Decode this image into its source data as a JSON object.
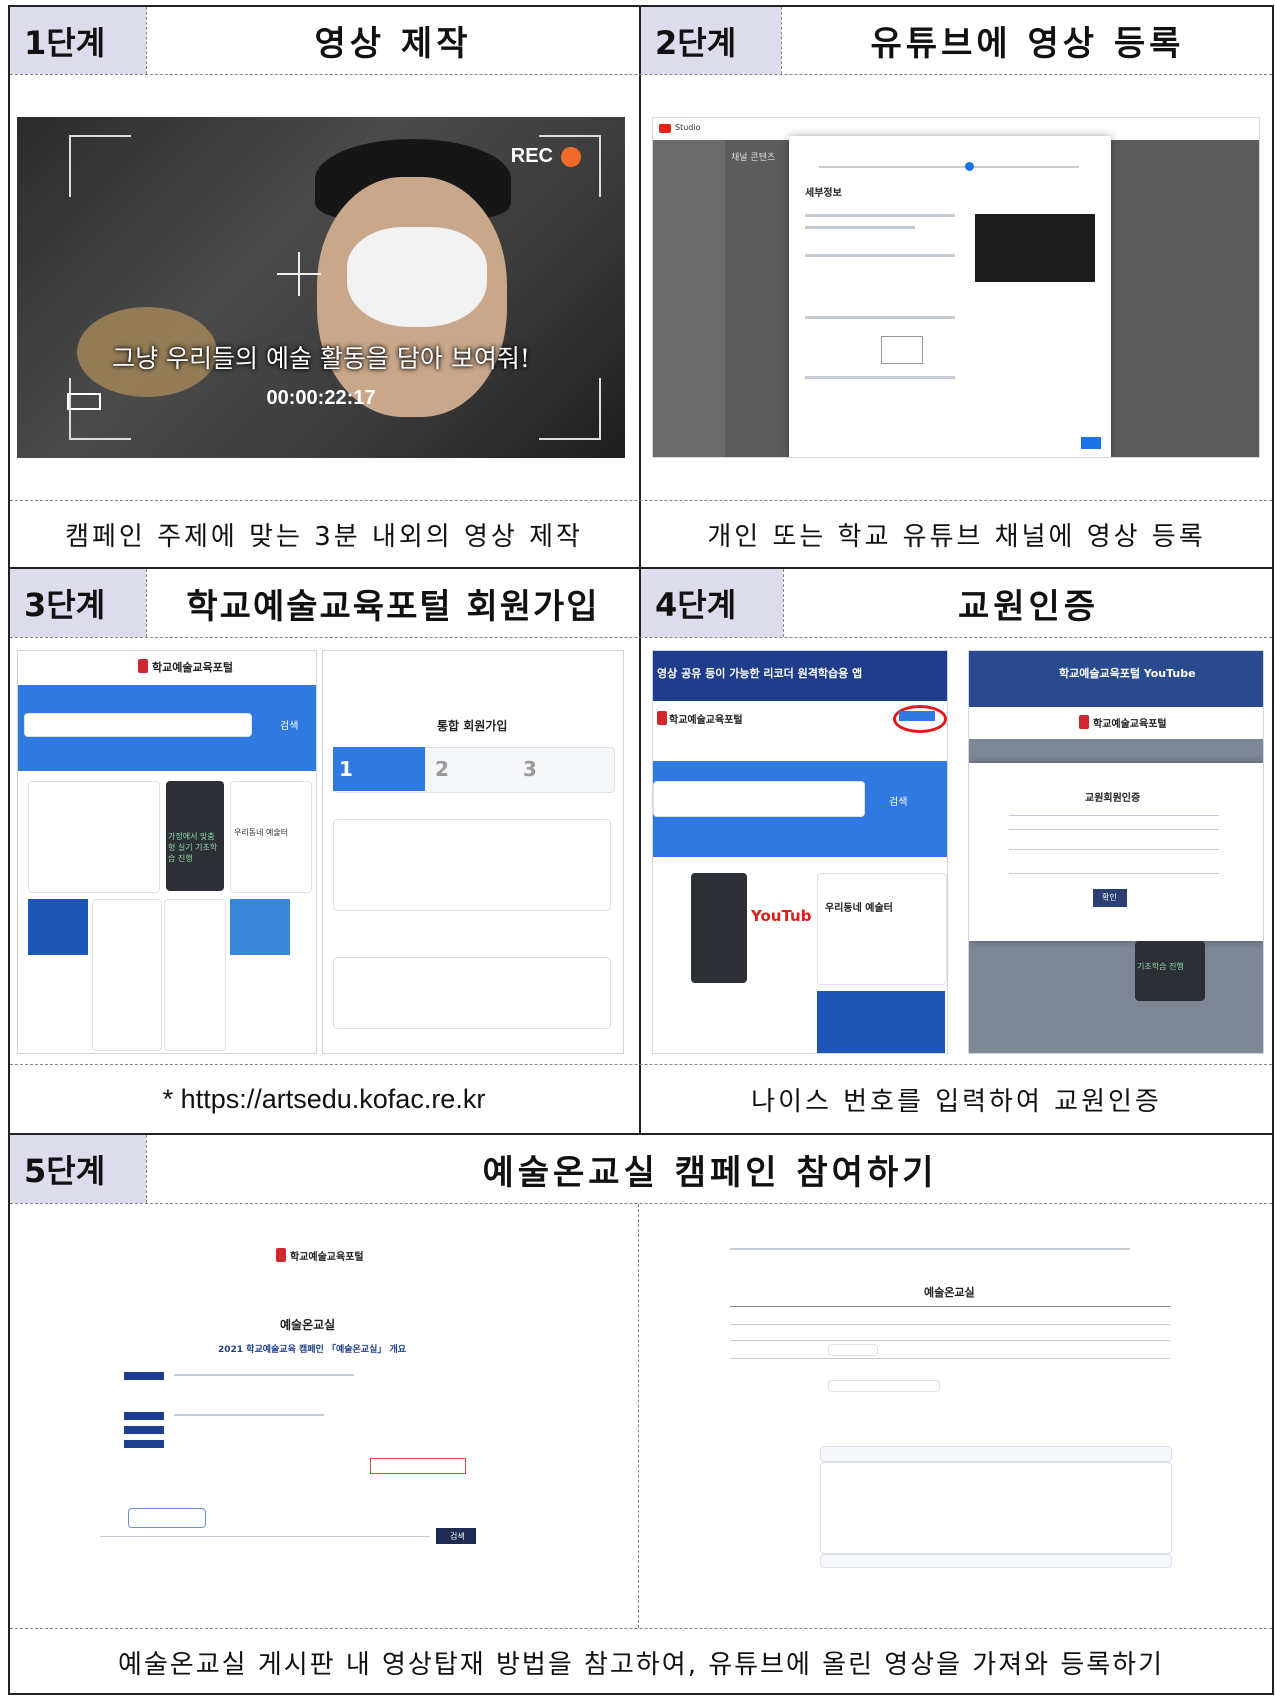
{
  "steps": [
    {
      "label": "1단계",
      "title": "영상 제작",
      "caption": "캠페인 주제에 맞는 3분 내외의 영상 제작"
    },
    {
      "label": "2단계",
      "title": "유튜브에 영상 등록",
      "caption": "개인 또는 학교 유튜브 채널에 영상 등록"
    },
    {
      "label": "3단계",
      "title": "학교예술교육포털 회원가입",
      "caption": "* https://artsedu.kofac.re.kr"
    },
    {
      "label": "4단계",
      "title": "교원인증",
      "caption": "나이스 번호를 입력하여 교원인증"
    },
    {
      "label": "5단계",
      "title": "예술온교실 캠페인 참여하기",
      "caption": "예술온교실 게시판 내 영상탑재 방법을 참고하여, 유튜브에 올린 영상을 가져와 등록하기"
    }
  ],
  "screens": {
    "camera": {
      "rec": "REC",
      "overlay": "그냥 우리들의 예술 활동을 담아 보여줘!",
      "timecode": "00:00:22:17"
    },
    "youtube": {
      "brand": "Studio",
      "panel_title": "채널 콘텐츠",
      "modal_heading": "세부정보"
    },
    "portal": {
      "logo": "학교예술교육포털",
      "search_btn": "검색",
      "promo": "가정에서 맞춤형 실기 기초학습 진행",
      "neighborhood": "우리동네 예술터"
    },
    "signup": {
      "heading": "통합 회원가입",
      "step1": "1",
      "step2": "2",
      "step3": "3"
    },
    "portal2": {
      "banner": "영상 공유 등이 가능한 리코더 원격학습용 앱",
      "logo": "학교예술교육포털",
      "search_btn": "검색",
      "youtube": "YouTub",
      "neighborhood": "우리동네 예술터"
    },
    "teacher": {
      "banner": "학교예술교육포털 YouTube",
      "logo": "학교예술교육포털",
      "modal_title": "교원회원인증",
      "ok": "확인",
      "promo": "기초학습 진행"
    },
    "campaign": {
      "logo": "학교예술교육포털",
      "page_title": "예술온교실",
      "subtitle": "2021 학교예술교육 캠페인 「예술온교실」 개요",
      "search_btn": "검색"
    },
    "board": {
      "page_title": "예술온교실"
    }
  }
}
